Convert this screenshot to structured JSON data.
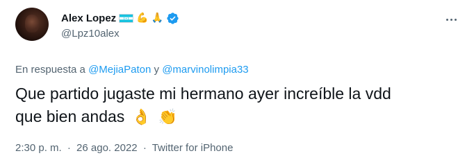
{
  "user": {
    "display_name": "Alex Lopez",
    "handle": "@Lpz10alex",
    "name_emojis": [
      "💪",
      "🙏"
    ]
  },
  "reply": {
    "prefix": "En respuesta a",
    "mention_1": "@MejiaPaton",
    "conjunction": "y",
    "mention_2": "@marvinolimpia33"
  },
  "tweet": {
    "line_1": "Que partido jugaste mi hermano ayer increíble la vdd",
    "line_2": "que bien andas",
    "emojis": [
      "👌",
      "👏"
    ]
  },
  "meta": {
    "time": "2:30 p. m.",
    "separator": "·",
    "date": "26 ago. 2022",
    "source": "Twitter for iPhone"
  },
  "colors": {
    "accent": "#1d9bf0",
    "secondary_text": "#536471",
    "primary_text": "#0f1419"
  },
  "icons": {
    "flag": "honduras-flag-icon",
    "verified": "verified-badge-icon",
    "more": "more-options-icon"
  }
}
